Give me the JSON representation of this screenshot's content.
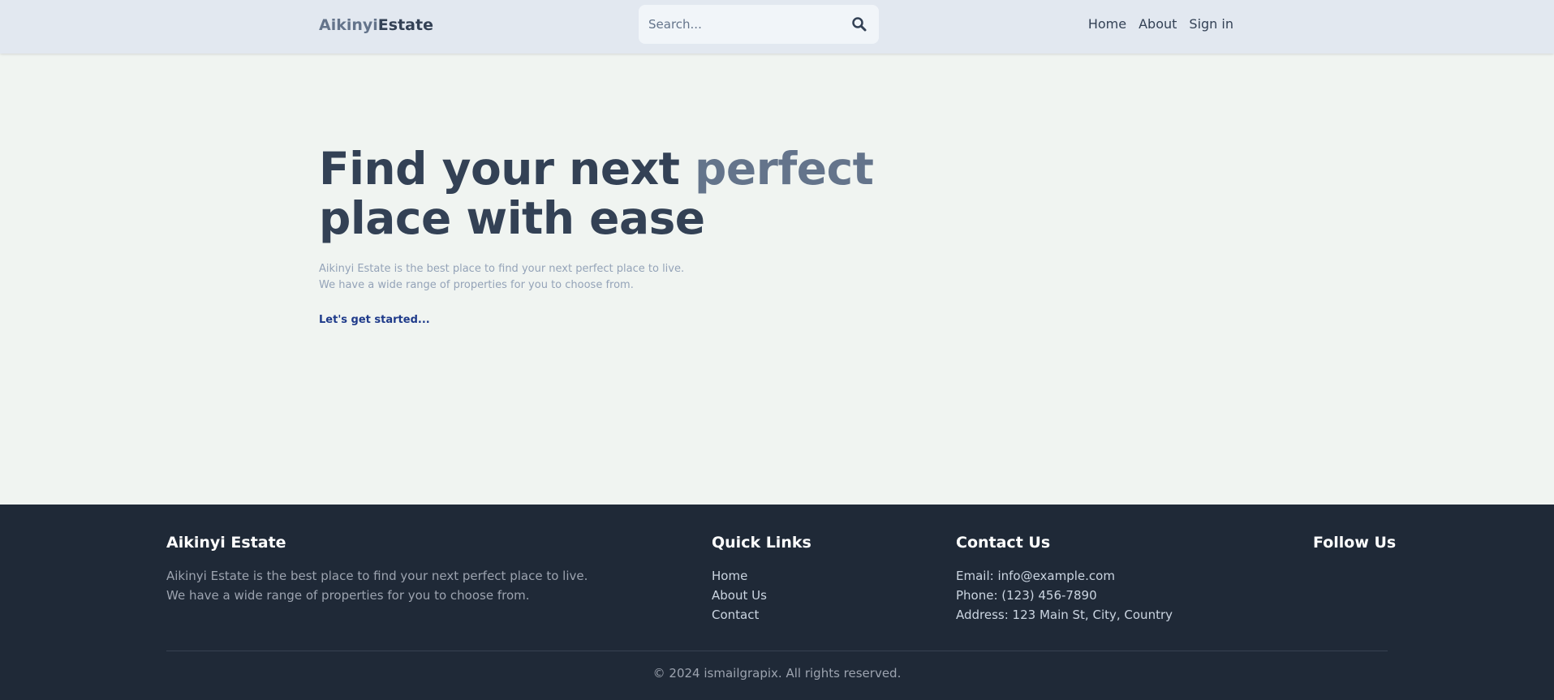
{
  "header": {
    "logo_part1": "Aikinyi",
    "logo_part2": "Estate",
    "search": {
      "placeholder": "Search..."
    },
    "nav": {
      "home": "Home",
      "about": "About",
      "signin": "Sign in"
    }
  },
  "hero": {
    "title_part1": "Find your next ",
    "title_accent": "perfect",
    "title_line2": "place with ease",
    "desc_line1": "Aikinyi Estate is the best place to find your next perfect place to live.",
    "desc_line2": "We have a wide range of properties for you to choose from.",
    "cta": "Let's get started..."
  },
  "footer": {
    "about": {
      "heading": "Aikinyi Estate",
      "line1": "Aikinyi Estate is the best place to find your next perfect place to live.",
      "line2": "We have a wide range of properties for you to choose from."
    },
    "quick_links": {
      "heading": "Quick Links",
      "items": [
        "Home",
        "About Us",
        "Contact"
      ]
    },
    "contact": {
      "heading": "Contact Us",
      "email": "Email: info@example.com",
      "phone": "Phone: (123) 456-7890",
      "address": "Address: 123 Main St, City, Country"
    },
    "follow": {
      "heading": "Follow Us"
    },
    "copyright": "© 2024 ismailgrapix. All rights reserved."
  },
  "icons": {
    "search": "search-icon"
  },
  "colors": {
    "header_bg": "#e2e8f0",
    "page_bg": "#f0f4f1",
    "primary_text": "#334155",
    "accent_text": "#64748b",
    "cta": "#1e3a8a",
    "footer_bg": "#1f2937"
  }
}
